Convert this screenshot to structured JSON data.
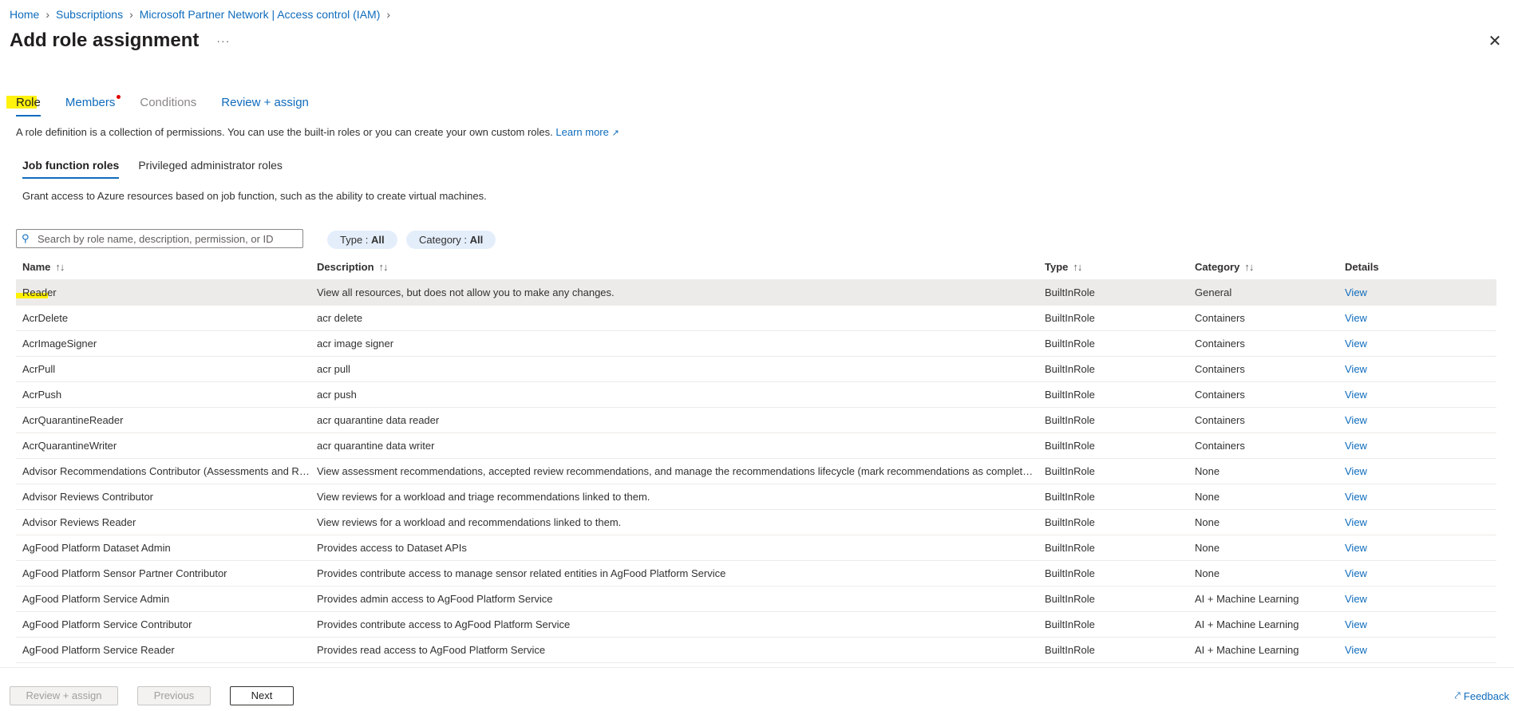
{
  "breadcrumb": [
    "Home",
    "Subscriptions",
    "Microsoft Partner Network | Access control (IAM)"
  ],
  "title": "Add role assignment",
  "more": "···",
  "tabs": [
    {
      "label": "Role",
      "state": "active"
    },
    {
      "label": "Members",
      "state": "normal",
      "required_dot": true
    },
    {
      "label": "Conditions",
      "state": "disabled"
    },
    {
      "label": "Review + assign",
      "state": "normal"
    }
  ],
  "intro": {
    "text": "A role definition is a collection of permissions. You can use the built-in roles or you can create your own custom roles.",
    "link": "Learn more"
  },
  "subtabs": [
    "Job function roles",
    "Privileged administrator roles"
  ],
  "subdesc": "Grant access to Azure resources based on job function, such as the ability to create virtual machines.",
  "search": {
    "placeholder": "Search by role name, description, permission, or ID"
  },
  "filters": {
    "type": {
      "label": "Type : ",
      "value": "All"
    },
    "category": {
      "label": "Category : ",
      "value": "All"
    }
  },
  "columns": {
    "name": "Name",
    "description": "Description",
    "type": "Type",
    "category": "Category",
    "details": "Details"
  },
  "rows": [
    {
      "name": "Reader",
      "description": "View all resources, but does not allow you to make any changes.",
      "type": "BuiltInRole",
      "category": "General",
      "details": "View"
    },
    {
      "name": "AcrDelete",
      "description": "acr delete",
      "type": "BuiltInRole",
      "category": "Containers",
      "details": "View"
    },
    {
      "name": "AcrImageSigner",
      "description": "acr image signer",
      "type": "BuiltInRole",
      "category": "Containers",
      "details": "View"
    },
    {
      "name": "AcrPull",
      "description": "acr pull",
      "type": "BuiltInRole",
      "category": "Containers",
      "details": "View"
    },
    {
      "name": "AcrPush",
      "description": "acr push",
      "type": "BuiltInRole",
      "category": "Containers",
      "details": "View"
    },
    {
      "name": "AcrQuarantineReader",
      "description": "acr quarantine data reader",
      "type": "BuiltInRole",
      "category": "Containers",
      "details": "View"
    },
    {
      "name": "AcrQuarantineWriter",
      "description": "acr quarantine data writer",
      "type": "BuiltInRole",
      "category": "Containers",
      "details": "View"
    },
    {
      "name": "Advisor Recommendations Contributor (Assessments and Re...",
      "description": "View assessment recommendations, accepted review recommendations, and manage the recommendations lifecycle (mark recommendations as completed,...",
      "type": "BuiltInRole",
      "category": "None",
      "details": "View"
    },
    {
      "name": "Advisor Reviews Contributor",
      "description": "View reviews for a workload and triage recommendations linked to them.",
      "type": "BuiltInRole",
      "category": "None",
      "details": "View"
    },
    {
      "name": "Advisor Reviews Reader",
      "description": "View reviews for a workload and recommendations linked to them.",
      "type": "BuiltInRole",
      "category": "None",
      "details": "View"
    },
    {
      "name": "AgFood Platform Dataset Admin",
      "description": "Provides access to Dataset APIs",
      "type": "BuiltInRole",
      "category": "None",
      "details": "View"
    },
    {
      "name": "AgFood Platform Sensor Partner Contributor",
      "description": "Provides contribute access to manage sensor related entities in AgFood Platform Service",
      "type": "BuiltInRole",
      "category": "None",
      "details": "View"
    },
    {
      "name": "AgFood Platform Service Admin",
      "description": "Provides admin access to AgFood Platform Service",
      "type": "BuiltInRole",
      "category": "AI + Machine Learning",
      "details": "View"
    },
    {
      "name": "AgFood Platform Service Contributor",
      "description": "Provides contribute access to AgFood Platform Service",
      "type": "BuiltInRole",
      "category": "AI + Machine Learning",
      "details": "View"
    },
    {
      "name": "AgFood Platform Service Reader",
      "description": "Provides read access to AgFood Platform Service",
      "type": "BuiltInRole",
      "category": "AI + Machine Learning",
      "details": "View"
    }
  ],
  "footer": {
    "review": "Review + assign",
    "previous": "Previous",
    "next": "Next",
    "feedback": "Feedback"
  }
}
